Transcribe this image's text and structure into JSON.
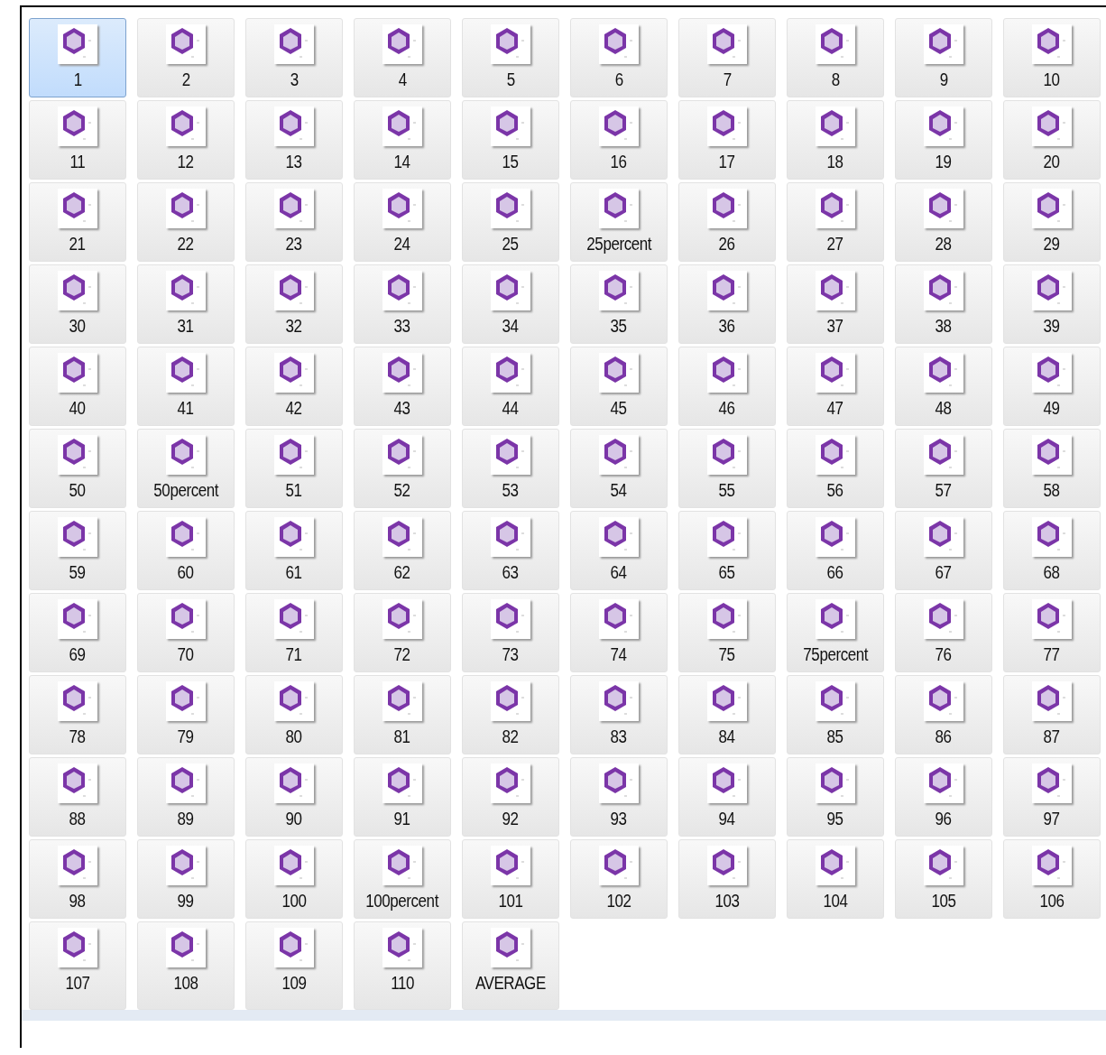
{
  "files": [
    {
      "label": "1",
      "selected": true
    },
    {
      "label": "2",
      "selected": false
    },
    {
      "label": "3",
      "selected": false
    },
    {
      "label": "4",
      "selected": false
    },
    {
      "label": "5",
      "selected": false
    },
    {
      "label": "6",
      "selected": false
    },
    {
      "label": "7",
      "selected": false
    },
    {
      "label": "8",
      "selected": false
    },
    {
      "label": "9",
      "selected": false
    },
    {
      "label": "10",
      "selected": false
    },
    {
      "label": "11",
      "selected": false
    },
    {
      "label": "12",
      "selected": false
    },
    {
      "label": "13",
      "selected": false
    },
    {
      "label": "14",
      "selected": false
    },
    {
      "label": "15",
      "selected": false
    },
    {
      "label": "16",
      "selected": false
    },
    {
      "label": "17",
      "selected": false
    },
    {
      "label": "18",
      "selected": false
    },
    {
      "label": "19",
      "selected": false
    },
    {
      "label": "20",
      "selected": false
    },
    {
      "label": "21",
      "selected": false
    },
    {
      "label": "22",
      "selected": false
    },
    {
      "label": "23",
      "selected": false
    },
    {
      "label": "24",
      "selected": false
    },
    {
      "label": "25",
      "selected": false
    },
    {
      "label": "25percent",
      "selected": false
    },
    {
      "label": "26",
      "selected": false
    },
    {
      "label": "27",
      "selected": false
    },
    {
      "label": "28",
      "selected": false
    },
    {
      "label": "29",
      "selected": false
    },
    {
      "label": "30",
      "selected": false
    },
    {
      "label": "31",
      "selected": false
    },
    {
      "label": "32",
      "selected": false
    },
    {
      "label": "33",
      "selected": false
    },
    {
      "label": "34",
      "selected": false
    },
    {
      "label": "35",
      "selected": false
    },
    {
      "label": "36",
      "selected": false
    },
    {
      "label": "37",
      "selected": false
    },
    {
      "label": "38",
      "selected": false
    },
    {
      "label": "39",
      "selected": false
    },
    {
      "label": "40",
      "selected": false
    },
    {
      "label": "41",
      "selected": false
    },
    {
      "label": "42",
      "selected": false
    },
    {
      "label": "43",
      "selected": false
    },
    {
      "label": "44",
      "selected": false
    },
    {
      "label": "45",
      "selected": false
    },
    {
      "label": "46",
      "selected": false
    },
    {
      "label": "47",
      "selected": false
    },
    {
      "label": "48",
      "selected": false
    },
    {
      "label": "49",
      "selected": false
    },
    {
      "label": "50",
      "selected": false
    },
    {
      "label": "50percent",
      "selected": false
    },
    {
      "label": "51",
      "selected": false
    },
    {
      "label": "52",
      "selected": false
    },
    {
      "label": "53",
      "selected": false
    },
    {
      "label": "54",
      "selected": false
    },
    {
      "label": "55",
      "selected": false
    },
    {
      "label": "56",
      "selected": false
    },
    {
      "label": "57",
      "selected": false
    },
    {
      "label": "58",
      "selected": false
    },
    {
      "label": "59",
      "selected": false
    },
    {
      "label": "60",
      "selected": false
    },
    {
      "label": "61",
      "selected": false
    },
    {
      "label": "62",
      "selected": false
    },
    {
      "label": "63",
      "selected": false
    },
    {
      "label": "64",
      "selected": false
    },
    {
      "label": "65",
      "selected": false
    },
    {
      "label": "66",
      "selected": false
    },
    {
      "label": "67",
      "selected": false
    },
    {
      "label": "68",
      "selected": false
    },
    {
      "label": "69",
      "selected": false
    },
    {
      "label": "70",
      "selected": false
    },
    {
      "label": "71",
      "selected": false
    },
    {
      "label": "72",
      "selected": false
    },
    {
      "label": "73",
      "selected": false
    },
    {
      "label": "74",
      "selected": false
    },
    {
      "label": "75",
      "selected": false
    },
    {
      "label": "75percent",
      "selected": false
    },
    {
      "label": "76",
      "selected": false
    },
    {
      "label": "77",
      "selected": false
    },
    {
      "label": "78",
      "selected": false
    },
    {
      "label": "79",
      "selected": false
    },
    {
      "label": "80",
      "selected": false
    },
    {
      "label": "81",
      "selected": false
    },
    {
      "label": "82",
      "selected": false
    },
    {
      "label": "83",
      "selected": false
    },
    {
      "label": "84",
      "selected": false
    },
    {
      "label": "85",
      "selected": false
    },
    {
      "label": "86",
      "selected": false
    },
    {
      "label": "87",
      "selected": false
    },
    {
      "label": "88",
      "selected": false
    },
    {
      "label": "89",
      "selected": false
    },
    {
      "label": "90",
      "selected": false
    },
    {
      "label": "91",
      "selected": false
    },
    {
      "label": "92",
      "selected": false
    },
    {
      "label": "93",
      "selected": false
    },
    {
      "label": "94",
      "selected": false
    },
    {
      "label": "95",
      "selected": false
    },
    {
      "label": "96",
      "selected": false
    },
    {
      "label": "97",
      "selected": false
    },
    {
      "label": "98",
      "selected": false
    },
    {
      "label": "99",
      "selected": false
    },
    {
      "label": "100",
      "selected": false
    },
    {
      "label": "100percent",
      "selected": false
    },
    {
      "label": "101",
      "selected": false
    },
    {
      "label": "102",
      "selected": false
    },
    {
      "label": "103",
      "selected": false
    },
    {
      "label": "104",
      "selected": false
    },
    {
      "label": "105",
      "selected": false
    },
    {
      "label": "106",
      "selected": false
    },
    {
      "label": "107",
      "selected": false
    },
    {
      "label": "108",
      "selected": false
    },
    {
      "label": "109",
      "selected": false
    },
    {
      "label": "110",
      "selected": false
    },
    {
      "label": "AVERAGE",
      "selected": false
    }
  ]
}
